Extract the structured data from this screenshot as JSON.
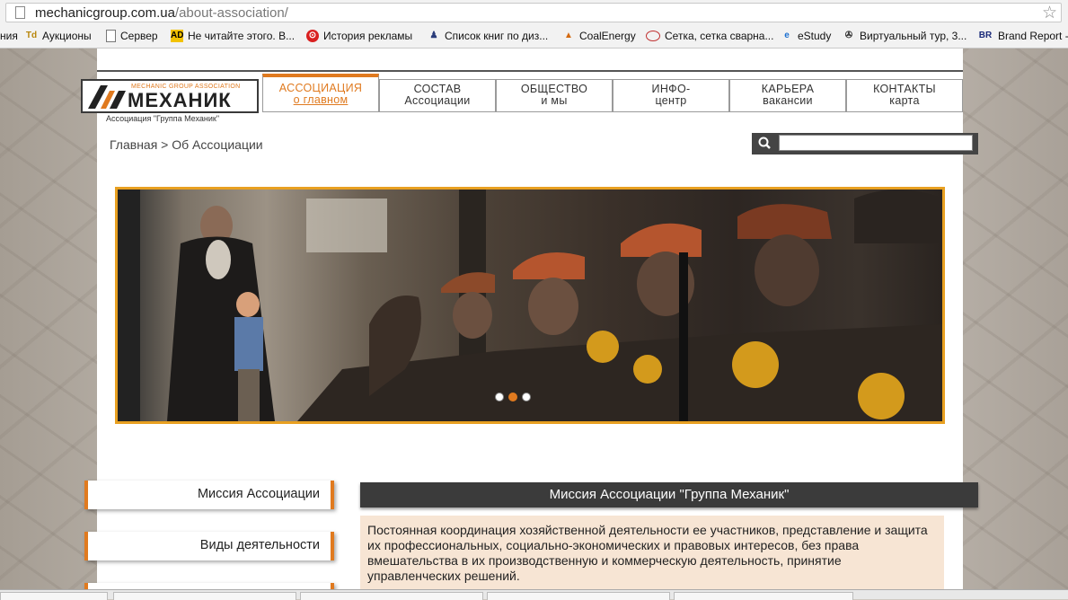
{
  "browser": {
    "url_host": "mechanicgroup.com.ua",
    "url_path": "/about-association/",
    "bookmarks": [
      {
        "label": "ния",
        "icon": ""
      },
      {
        "label": "Аукционы",
        "icon": "auction-icon"
      },
      {
        "label": "Сервер",
        "icon": "page-icon"
      },
      {
        "label": "Не читайте этого. В...",
        "icon": "ad-icon"
      },
      {
        "label": "История рекламы",
        "icon": "red-circle-icon"
      },
      {
        "label": "Список книг по диз...",
        "icon": "user-icon"
      },
      {
        "label": "CoalEnergy",
        "icon": "flame-icon"
      },
      {
        "label": "Сетка, сетка сварна...",
        "icon": "oval-icon"
      },
      {
        "label": "eStudy",
        "icon": "ie-icon"
      },
      {
        "label": "Виртуальный тур, 3...",
        "icon": "vt-icon"
      },
      {
        "label": "Brand Report -",
        "icon": "br-icon"
      }
    ]
  },
  "logo": {
    "small": "MECHANIC GROUP ASSOCIATION",
    "name": "МЕХАНИК",
    "caption": "Ассоциация \"Группа Механик\""
  },
  "nav": [
    {
      "line1": "АССОЦИАЦИЯ",
      "line2": "о главном",
      "active": true
    },
    {
      "line1": "СОСТАВ",
      "line2": "Ассоциации"
    },
    {
      "line1": "ОБЩЕСТВО",
      "line2": "и мы"
    },
    {
      "line1": "ИНФО-",
      "line2": "центр"
    },
    {
      "line1": "КАРЬЕРА",
      "line2": "вакансии"
    },
    {
      "line1": "КОНТАКТЫ",
      "line2": "карта"
    }
  ],
  "breadcrumb": "Главная > Об Ассоциации",
  "search": {
    "placeholder": "",
    "value": ""
  },
  "slider": {
    "slides": 3,
    "active_index": 1
  },
  "side_menu": [
    "Миссия Ассоциации",
    "Виды деятельности"
  ],
  "mission": {
    "heading": "Миссия Ассоциации \"Группа Механик\"",
    "text": "Постоянная координация хозяйственной деятельности ее участников, представление и защита их профессиональных, социально-экономических и правовых интересов, без права вмешательства в их производственную и коммерческую деятельность, принятие управленческих решений."
  },
  "colors": {
    "accent": "#e07a1f",
    "banner_border": "#e8a021",
    "dark": "#3b3b3b",
    "mission_bg": "#f7e5d4"
  }
}
